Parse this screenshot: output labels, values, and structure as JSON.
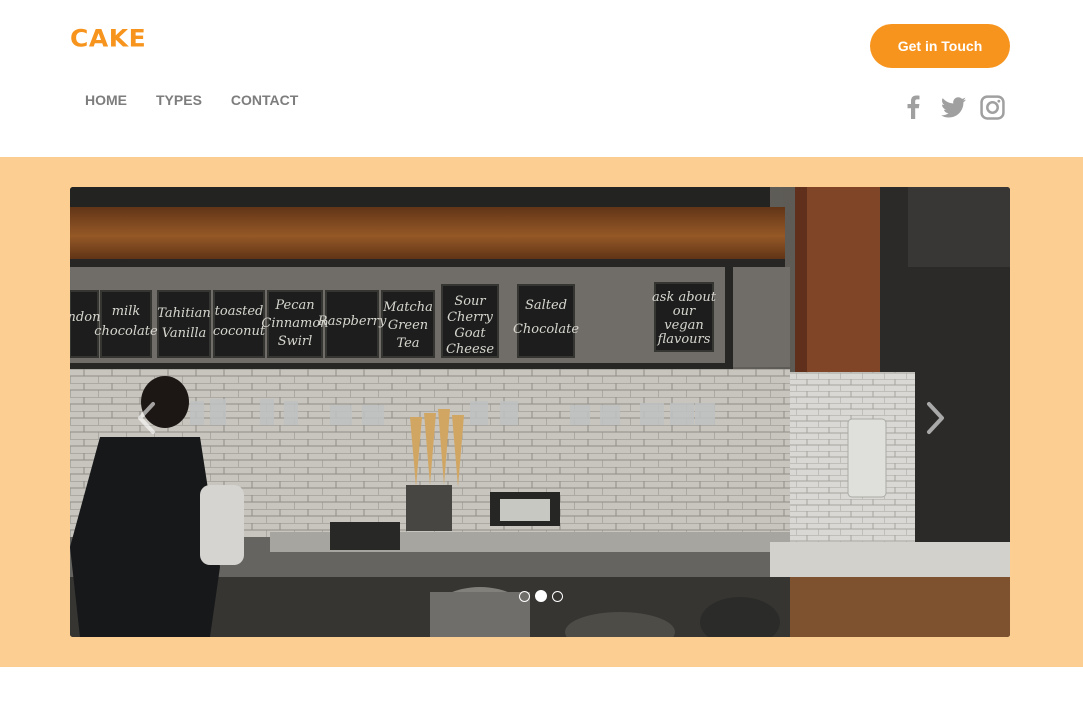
{
  "brand": {
    "logo_text": "CAKE",
    "accent_color": "#f7941d"
  },
  "nav": {
    "items": [
      {
        "label": "HOME"
      },
      {
        "label": "TYPES"
      },
      {
        "label": "CONTACT"
      }
    ]
  },
  "header": {
    "cta_label": "Get in Touch"
  },
  "social": {
    "icons": [
      "facebook-icon",
      "twitter-icon",
      "instagram-icon"
    ],
    "color": "#a0a0a0"
  },
  "hero": {
    "band_color": "#fdce92",
    "carousel": {
      "slide_count": 3,
      "active_index": 1,
      "prev_icon": "chevron-left-icon",
      "next_icon": "chevron-right-icon",
      "image_alt": "Photo of a coffee and ice cream shop counter with chalkboard flavor signs",
      "chalk_signs": [
        "ndon",
        "milk chocolate",
        "Tahitian Vanilla",
        "toasted coconut",
        "Pecan Cinnamon Swirl",
        "Raspberry",
        "Matcha Green Tea",
        "Sour Cherry Goat Cheese",
        "Salted Chocolate",
        "ask about our vegan flavours"
      ]
    }
  }
}
